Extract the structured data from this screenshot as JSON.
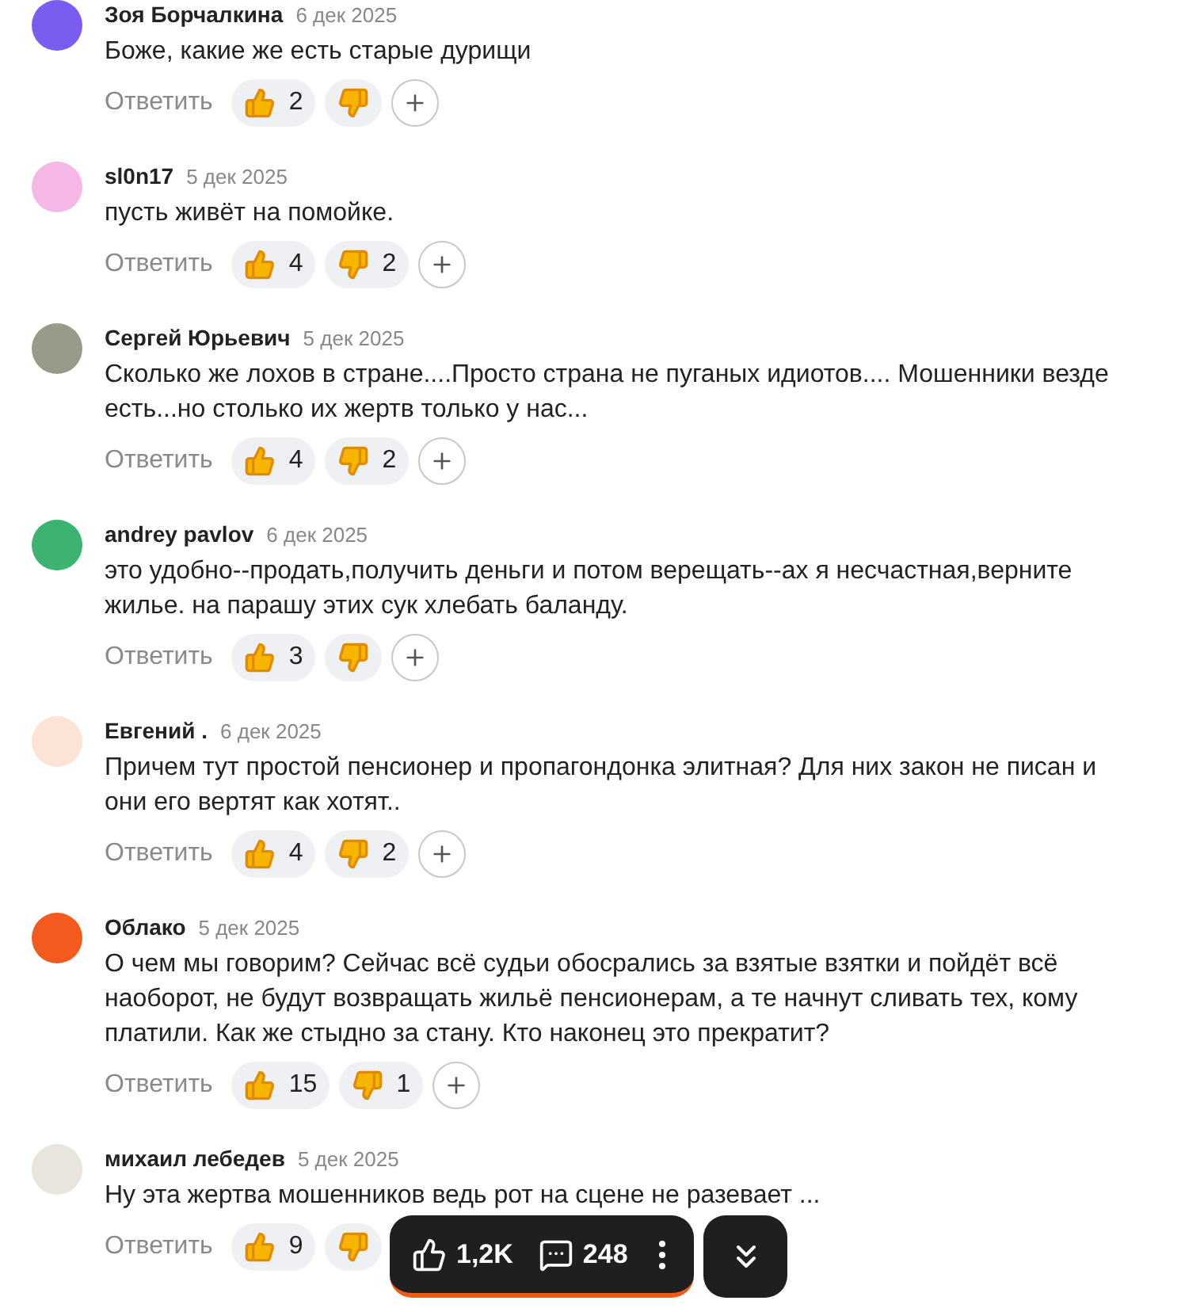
{
  "comments": [
    {
      "author": "Зоя Борчалкина",
      "date": "6 дек 2025",
      "color": "#7b5cf0",
      "text": "Боже, какие же есть старые дурищи",
      "reply": "Ответить",
      "likes": "2"
    },
    {
      "author": "sl0n17",
      "date": "5 дек 2025",
      "color": "#f5b8e6",
      "text": "пусть живёт на помойке.",
      "reply": "Ответить",
      "likes": "4",
      "dislikes": "2"
    },
    {
      "author": "Сергей Юрьевич",
      "date": "5 дек 2025",
      "color": "#9a9a8a",
      "text": "Сколько же лохов в стране....Просто страна не пуганых идиотов.... Мошенники везде есть...но столько их жертв только у нас...",
      "reply": "Ответить",
      "likes": "4",
      "dislikes": "2"
    },
    {
      "author": "andrey pavlov",
      "date": "6 дек 2025",
      "color": "#3cb371",
      "text": "это удобно--продать,получить деньги и потом верещать--ах я несчастная,верните жилье. на парашу этих сук хлебать баланду.",
      "reply": "Ответить",
      "likes": "3"
    },
    {
      "author": "Евгений .",
      "date": "6 дек 2025",
      "color": "#fbe3d6",
      "text": "Причем тут простой пенсионер и пропагондонка элитная? Для них закон не писан и они его вертят как хотят..",
      "reply": "Ответить",
      "likes": "4",
      "dislikes": "2"
    },
    {
      "author": "Облако",
      "date": "5 дек 2025",
      "color": "#f25a1e",
      "text": "О чем мы говорим? Сейчас всё судьи обосрались за взятые взятки и пойдёт всё наоборот, не будут возвращать жильё пенсионерам, а те начнут сливать тех, кому платили. Как же стыдно за стану. Кто наконец это прекратит?",
      "reply": "Ответить",
      "likes": "15",
      "dislikes": "1"
    },
    {
      "author": "михаил лебедев",
      "date": "5 дек 2025",
      "color": "#e9e4de",
      "text": "Ну эта жертва мошенников ведь рот на сцене не разевает ...",
      "reply": "Ответить",
      "likes": "9"
    }
  ],
  "floating_bar": {
    "likes": "1,2K",
    "comments": "248"
  }
}
